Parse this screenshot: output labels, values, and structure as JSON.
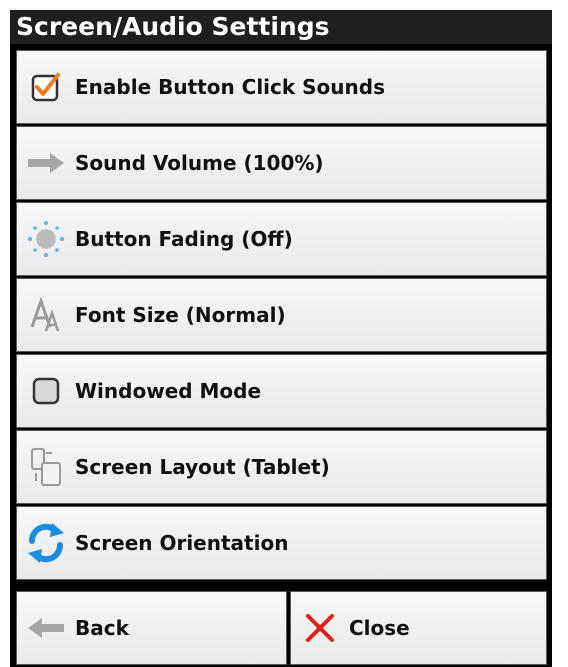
{
  "window": {
    "title": "Screen/Audio Settings"
  },
  "items": [
    {
      "label": "Enable Button Click Sounds",
      "icon": "checkbox-checked-icon",
      "checked": true
    },
    {
      "label": "Sound Volume (100%)",
      "icon": "arrow-right-icon"
    },
    {
      "label": "Button Fading (Off)",
      "icon": "fade-dots-icon"
    },
    {
      "label": "Font Size (Normal)",
      "icon": "font-size-icon"
    },
    {
      "label": "Windowed Mode",
      "icon": "checkbox-unchecked-icon",
      "checked": false
    },
    {
      "label": "Screen Layout (Tablet)",
      "icon": "screen-layout-icon"
    },
    {
      "label": "Screen Orientation",
      "icon": "rotate-icon"
    }
  ],
  "footer": {
    "back_label": "Back",
    "back_icon": "arrow-left-icon",
    "close_label": "Close",
    "close_icon": "close-icon"
  },
  "colors": {
    "accent_orange": "#f07c1f",
    "close_red": "#e0201b",
    "rotate_blue": "#1a8de0",
    "title_bg": "#1f1f1f"
  }
}
